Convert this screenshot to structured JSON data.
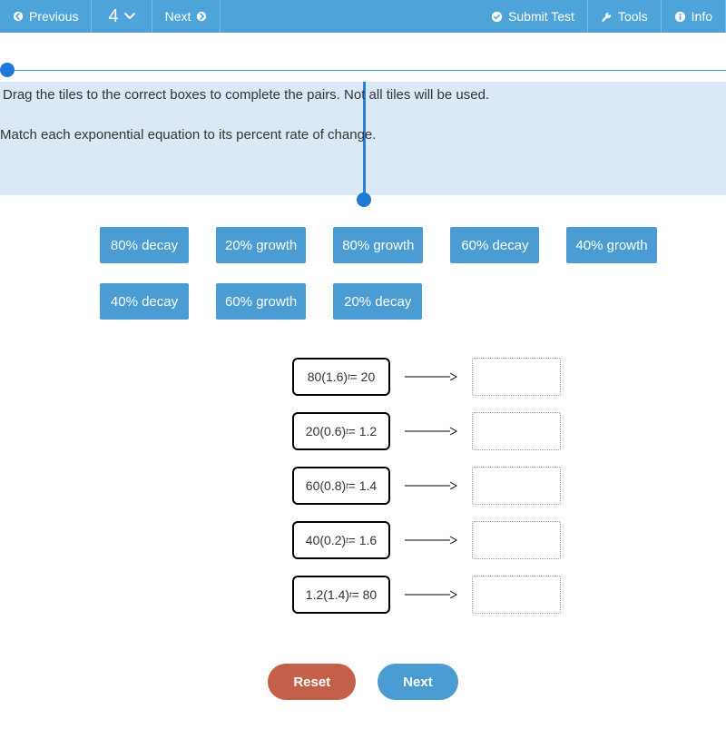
{
  "nav": {
    "previous": "Previous",
    "question_number": "4",
    "next": "Next",
    "submit": "Submit Test",
    "tools": "Tools",
    "info": "Info"
  },
  "instructions": {
    "line1": "Drag the tiles to the correct boxes to complete the pairs. Not all tiles will be used.",
    "line2": "Match each exponential equation to its percent rate of change."
  },
  "tiles_row1": [
    "80% decay",
    "20% growth",
    "80% growth",
    "60% decay",
    "40% growth"
  ],
  "tiles_row2": [
    "40% decay",
    "60% growth",
    "20% decay"
  ],
  "equations": [
    {
      "coef": "80",
      "base": "1.6",
      "rhs": "20"
    },
    {
      "coef": "20",
      "base": "0.6",
      "rhs": "1.2"
    },
    {
      "coef": "60",
      "base": "0.8",
      "rhs": "1.4"
    },
    {
      "coef": "40",
      "base": "0.2",
      "rhs": "1.6"
    },
    {
      "coef": "1.2",
      "base": "1.4",
      "rhs": "80"
    }
  ],
  "buttons": {
    "reset": "Reset",
    "next": "Next"
  }
}
